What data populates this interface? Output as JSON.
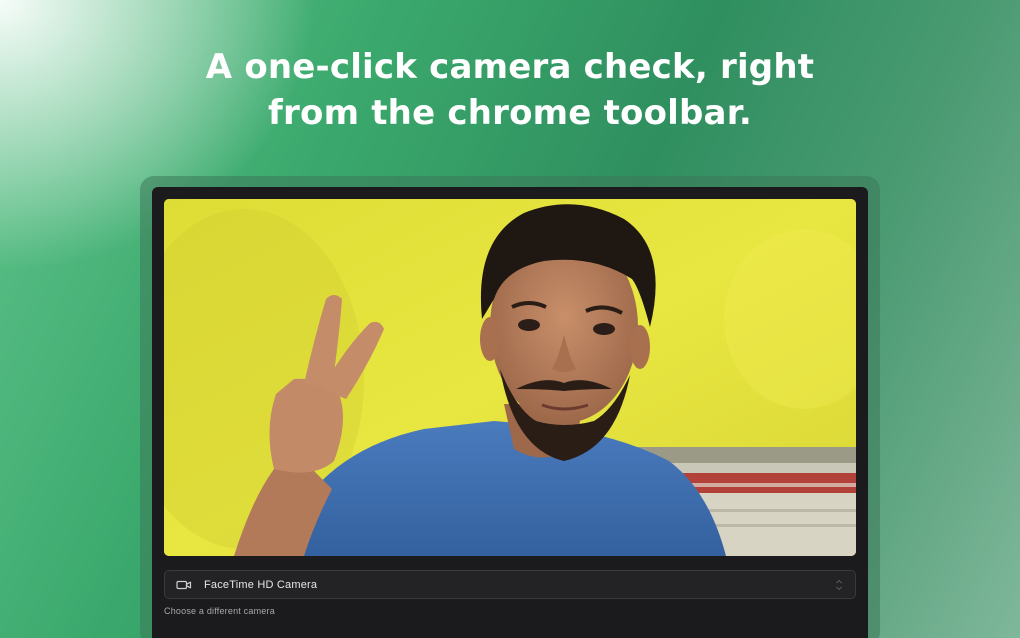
{
  "headline": {
    "line1": "A one-click camera check, right",
    "line2": "from the chrome toolbar."
  },
  "camera_select": {
    "icon": "video-camera-icon",
    "selected_value": "FaceTime HD Camera"
  },
  "hint": "Choose a different camera",
  "colors": {
    "background_green": "#3aa86c",
    "device_dark": "#1b1b1d",
    "video_wall_yellow": "#e4e23a",
    "shirt_blue": "#3f6fb0"
  }
}
